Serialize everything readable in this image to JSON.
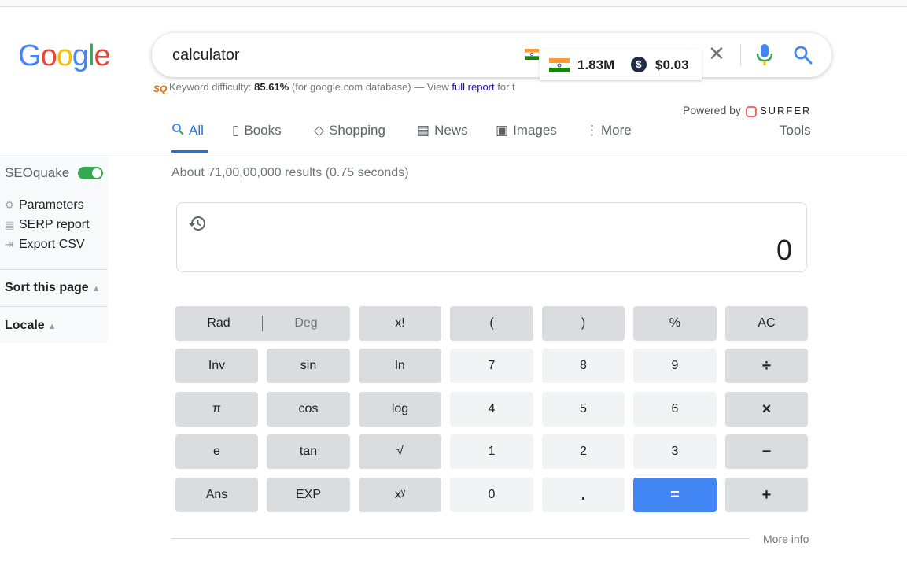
{
  "logo": {
    "letters": [
      "G",
      "o",
      "o",
      "g",
      "l",
      "e"
    ],
    "colors": [
      "#4285f4",
      "#ea4335",
      "#fbbc05",
      "#4285f4",
      "#34a853",
      "#ea4335"
    ]
  },
  "search": {
    "query": "calculator"
  },
  "seoquake_overlay": {
    "volume": "1.83M",
    "cpc": "$0.03",
    "dollar_symbol": "$"
  },
  "keyword_difficulty": {
    "label": "Keyword difficulty:",
    "value": "85.61%",
    "db_text": "(for google.com database) — View",
    "link": "full report",
    "tail": "for t"
  },
  "powered_by": {
    "label": "Powered by",
    "brand": "SURFER"
  },
  "tabs": [
    {
      "label": "All",
      "icon": "🔍"
    },
    {
      "label": "Books",
      "icon": "▯"
    },
    {
      "label": "Shopping",
      "icon": "◇"
    },
    {
      "label": "News",
      "icon": "▤"
    },
    {
      "label": "Images",
      "icon": "▣"
    },
    {
      "label": "More",
      "icon": "⋮"
    }
  ],
  "tools_label": "Tools",
  "results_stats": "About 71,00,00,000 results (0.75 seconds)",
  "sidebar": {
    "title": "SEOquake",
    "items": [
      "Parameters",
      "SERP report",
      "Export CSV"
    ],
    "sort_label": "Sort this page",
    "locale_label": "Locale"
  },
  "calculator": {
    "display": "0",
    "rad": "Rad",
    "deg": "Deg",
    "keys": {
      "fact": "x!",
      "lparen": "(",
      "rparen": ")",
      "percent": "%",
      "ac": "AC",
      "inv": "Inv",
      "sin": "sin",
      "ln": "ln",
      "n7": "7",
      "n8": "8",
      "n9": "9",
      "divide": "÷",
      "pi": "π",
      "cos": "cos",
      "log": "log",
      "n4": "4",
      "n5": "5",
      "n6": "6",
      "multiply": "×",
      "e": "e",
      "tan": "tan",
      "sqrt": "√",
      "n1": "1",
      "n2": "2",
      "n3": "3",
      "minus": "−",
      "ans": "Ans",
      "exp": "EXP",
      "pow": "xʸ",
      "n0": "0",
      "dot": ".",
      "equals": "=",
      "plus": "+"
    }
  },
  "more_info": "More info"
}
